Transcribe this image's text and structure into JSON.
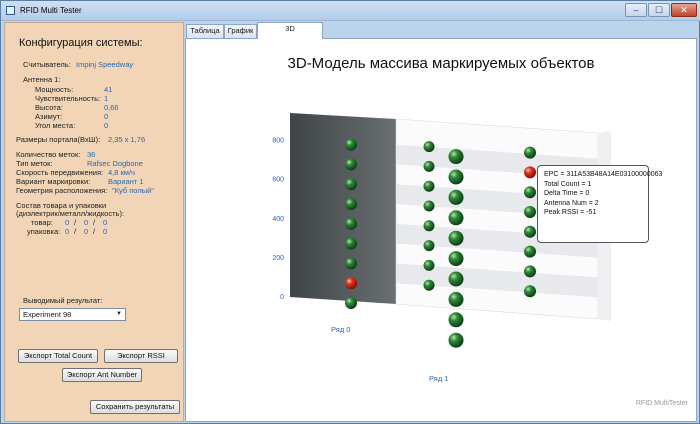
{
  "window": {
    "title": "RFID Multi Tester",
    "controls": {
      "minimize": "‒",
      "maximize": "☐",
      "close": "✕"
    }
  },
  "sidebar": {
    "heading": "Конфигурация системы:",
    "reader": {
      "label": "Считыватель:",
      "value": "Impinj Speedway"
    },
    "antenna": {
      "label": "Антенна 1:",
      "rows": [
        {
          "label": "Мощность:",
          "value": "41"
        },
        {
          "label": "Чувствительность:",
          "value": "1"
        },
        {
          "label": "Высота:",
          "value": "0,66"
        },
        {
          "label": "Азимут:",
          "value": "0"
        },
        {
          "label": "Угол места:",
          "value": "0"
        }
      ]
    },
    "portal": {
      "label": "Размеры портала(ВхШ):",
      "value": "2,35 x 1,76"
    },
    "tags": [
      {
        "label": "Количество меток:",
        "value": "36"
      },
      {
        "label": "Тип меток:",
        "value": "Rafsec Dogbone"
      },
      {
        "label": "Скорость передвижения:",
        "value": "4,8 км/ч"
      },
      {
        "label": "Вариант маркировки:",
        "value": "Вариант 1"
      },
      {
        "label": "Геометрия расположения:",
        "value": "\"Куб полый\""
      }
    ],
    "composition": {
      "label_line1": "Состав товара и упаковки",
      "label_line2": "(диэлектрик/металл/жидкость):",
      "product": {
        "label": "товар:",
        "v1": "0",
        "v2": "0",
        "v3": "0"
      },
      "package": {
        "label": "упаковка:",
        "v1": "0",
        "v2": "0",
        "v3": "0"
      },
      "sep": "/"
    },
    "result_label": "Выводимый результат:",
    "result_select": "Experiment 98",
    "buttons": {
      "export_total": "Экспорт Total Count",
      "export_rssi": "Экспорт RSSI",
      "export_ant": "Экспорт Ant Number",
      "save": "Сохранить результаты"
    }
  },
  "tabs": [
    {
      "label": "Таблица",
      "active": false
    },
    {
      "label": "График",
      "active": false
    },
    {
      "label": "3D",
      "active": true
    }
  ],
  "chart": {
    "title": "3D-Модель массива маркируемых объектов",
    "watermark": "RFID MultiTester",
    "tooltip": [
      "EPC = 311A53B48A14E03100000063",
      "Total Count = 1",
      "Delta Time = 0",
      "Antenna Num = 2",
      "Peak RSSI = -51"
    ],
    "colors": {
      "tag_ok": "#1e6b2a",
      "tag_fail": "#d0271a",
      "back_wall": "#505558",
      "grid_band": "#e7e9ec"
    }
  },
  "chart_data": {
    "type": "scatter",
    "title": "3D-Модель массива маркируемых объектов",
    "ylim": [
      0,
      800
    ],
    "yticks": [
      "0",
      "200",
      "400",
      "600",
      "800"
    ],
    "row_labels": [
      "Ряд 0",
      "Ряд 1"
    ],
    "series": [
      {
        "name": "",
        "column": 0,
        "y": [
          800,
          700,
          600,
          500,
          400,
          300,
          200,
          100,
          0
        ],
        "read": [
          1,
          1,
          1,
          1,
          1,
          1,
          1,
          0,
          1
        ]
      },
      {
        "name": "",
        "column": 1,
        "y": [
          800,
          700,
          600,
          500,
          400,
          300,
          200,
          100
        ],
        "read": [
          1,
          1,
          1,
          1,
          1,
          1,
          1,
          1
        ]
      },
      {
        "name": "",
        "column": 2,
        "y": [
          800,
          700,
          600,
          500,
          400,
          300,
          200,
          100,
          0,
          -100
        ],
        "read": [
          1,
          1,
          1,
          1,
          1,
          1,
          1,
          1,
          1,
          1
        ]
      },
      {
        "name": "",
        "column": 3,
        "y": [
          800,
          700,
          600,
          500,
          400,
          300,
          200,
          100
        ],
        "read": [
          1,
          0,
          1,
          1,
          1,
          1,
          1,
          1
        ]
      }
    ]
  }
}
